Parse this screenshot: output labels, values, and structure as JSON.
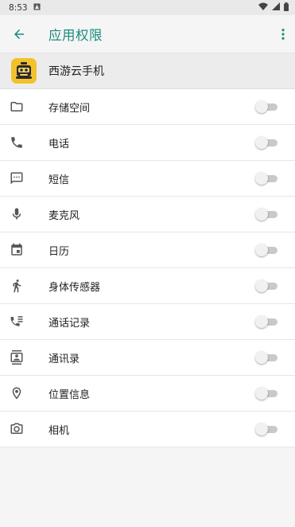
{
  "status_bar": {
    "time": "8:53",
    "notification_icon": "android-notification-icon"
  },
  "appbar": {
    "title": "应用权限",
    "back_icon": "arrow-back-icon",
    "more_icon": "more-vert-icon"
  },
  "app": {
    "name": "西游云手机",
    "icon": "app-robot-icon"
  },
  "permissions": [
    {
      "label": "存储空间",
      "icon": "folder-icon",
      "enabled": false
    },
    {
      "label": "电话",
      "icon": "phone-icon",
      "enabled": false
    },
    {
      "label": "短信",
      "icon": "sms-icon",
      "enabled": false
    },
    {
      "label": "麦克风",
      "icon": "mic-icon",
      "enabled": false
    },
    {
      "label": "日历",
      "icon": "calendar-icon",
      "enabled": false
    },
    {
      "label": "身体传感器",
      "icon": "body-sensor-icon",
      "enabled": false
    },
    {
      "label": "通话记录",
      "icon": "call-log-icon",
      "enabled": false
    },
    {
      "label": "通讯录",
      "icon": "contacts-icon",
      "enabled": false
    },
    {
      "label": "位置信息",
      "icon": "location-icon",
      "enabled": false
    },
    {
      "label": "相机",
      "icon": "camera-icon",
      "enabled": false
    }
  ],
  "colors": {
    "accent": "#1b8a7c",
    "app_icon_bg": "#f3c12b"
  }
}
